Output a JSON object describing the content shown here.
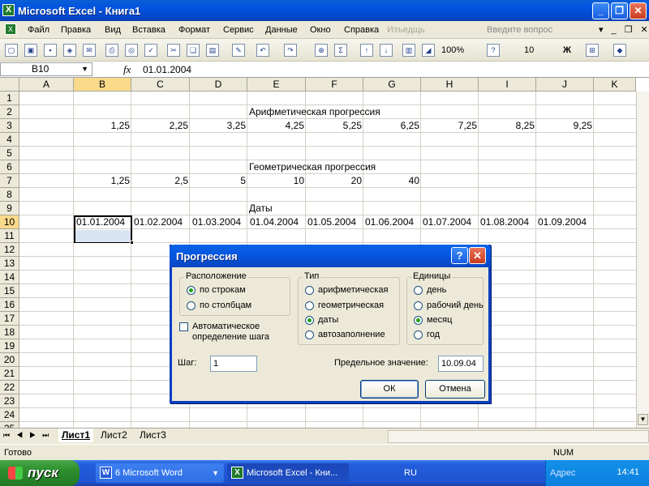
{
  "window": {
    "title": "Microsoft Excel - Книга1",
    "app_icon": "excel-icon"
  },
  "menu": {
    "items": [
      "Файл",
      "Правка",
      "Вид",
      "Вставка",
      "Формат",
      "Сервис",
      "Данные",
      "Окно",
      "Справка",
      "Изъедщь"
    ],
    "help_hint": "Введите вопрос"
  },
  "toolbar": {
    "zoom": "100%",
    "font_size": "10",
    "bold_label": "Ж"
  },
  "formula_bar": {
    "name_box": "B10",
    "fx_label": "fx",
    "value": "01.01.2004"
  },
  "sheet": {
    "columns": [
      "A",
      "B",
      "C",
      "D",
      "E",
      "F",
      "G",
      "H",
      "I",
      "J",
      "K"
    ],
    "rows": [
      "1",
      "2",
      "3",
      "4",
      "5",
      "6",
      "7",
      "8",
      "9",
      "10",
      "11",
      "12",
      "13",
      "14",
      "15",
      "16",
      "17",
      "18",
      "19",
      "20",
      "21",
      "22",
      "23",
      "24",
      "25"
    ],
    "selected_column": "B",
    "selected_row": "10",
    "cells": {
      "E2": "Арифметическая прогрессия",
      "row3": [
        "1,25",
        "2,25",
        "3,25",
        "4,25",
        "5,25",
        "6,25",
        "7,25",
        "8,25",
        "9,25"
      ],
      "E6": "Геометрическая прогрессия",
      "row7": [
        "1,25",
        "2,5",
        "5",
        "10",
        "20",
        "40"
      ],
      "E9": "Даты",
      "row10": [
        "01.01.2004",
        "01.02.2004",
        "01.03.2004",
        "01.04.2004",
        "01.05.2004",
        "01.06.2004",
        "01.07.2004",
        "01.08.2004",
        "01.09.2004"
      ]
    }
  },
  "tabs": {
    "sheets": [
      "Лист1",
      "Лист2",
      "Лист3"
    ],
    "active": "Лист1"
  },
  "status": {
    "text": "Готово",
    "num": "NUM"
  },
  "taskbar": {
    "start": "пуск",
    "tasks": [
      "6 Microsoft Word",
      "Microsoft Excel - Кни..."
    ],
    "lang": "RU",
    "address": "Адрес",
    "clock": "14:41"
  },
  "dialog": {
    "title": "Прогрессия",
    "help_button": "?",
    "location_group": "Расположение",
    "location_options": [
      "по строкам",
      "по столбцам"
    ],
    "location_selected": 0,
    "type_group": "Тип",
    "type_options": [
      "арифметическая",
      "геометрическая",
      "даты",
      "автозаполнение"
    ],
    "type_selected": 2,
    "units_group": "Единицы",
    "units_options": [
      "день",
      "рабочий день",
      "месяц",
      "год"
    ],
    "units_selected": 2,
    "auto_step_line1": "Автоматическое",
    "auto_step_line2": "определение шага",
    "auto_step_checked": false,
    "step_label": "Шаг:",
    "step_value": "1",
    "limit_label": "Предельное значение:",
    "limit_value": "10.09.04",
    "ok": "ОК",
    "cancel": "Отмена"
  }
}
